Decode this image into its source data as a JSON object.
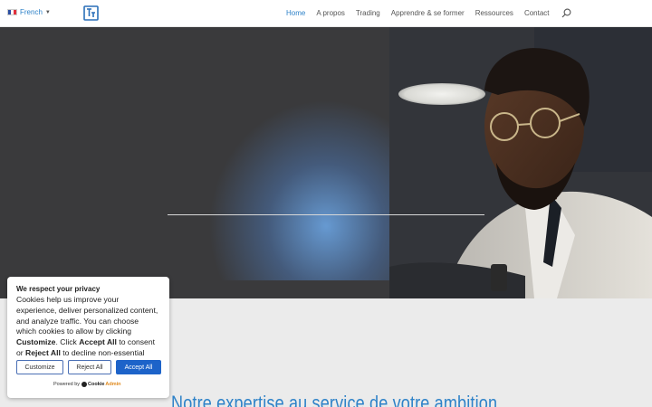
{
  "header": {
    "language": {
      "label": "French",
      "flag": "french-flag-icon"
    },
    "nav": [
      {
        "label": "Home",
        "active": true
      },
      {
        "label": "A propos",
        "active": false
      },
      {
        "label": "Trading",
        "active": false
      },
      {
        "label": "Apprendre & se former",
        "active": false
      },
      {
        "label": "Ressources",
        "active": false
      },
      {
        "label": "Contact",
        "active": false
      }
    ],
    "search_icon": "search-icon"
  },
  "section": {
    "title": "Notre expertise au service de votre ambition"
  },
  "cookie": {
    "title": "We respect your privacy",
    "body_1": "Cookies help us improve your experience, deliver personalized content, and analyze traffic. You can choose which cookies to allow by clicking ",
    "customize_em": "Customize",
    "body_2": ". Click ",
    "accept_em": "Accept All",
    "body_3": " to consent or ",
    "reject_em": "Reject All",
    "body_4": " to decline non-essential cookies.",
    "buttons": {
      "customize": "Customize",
      "reject": "Reject All",
      "accept": "Accept All"
    },
    "powered_by": "Powered by",
    "brand_a": "Cookie",
    "brand_b": "Admin"
  },
  "colors": {
    "accent": "#2e82c8",
    "accept_button": "#1d63c9",
    "hero_bg": "#3a3a3c",
    "section_bg": "#ebebeb"
  }
}
